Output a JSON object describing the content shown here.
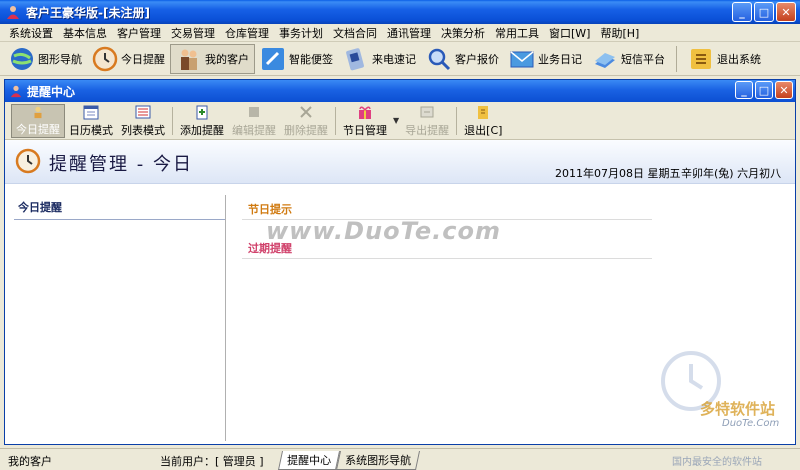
{
  "window": {
    "title": "客户王豪华版-[未注册]"
  },
  "menu": [
    "系统设置",
    "基本信息",
    "客户管理",
    "交易管理",
    "仓库管理",
    "事务计划",
    "文档合同",
    "通讯管理",
    "决策分析",
    "常用工具",
    "窗口[W]",
    "帮助[H]"
  ],
  "main_toolbar": [
    {
      "label": "图形导航",
      "icon": "globe-icon",
      "color": "#2a6ac8"
    },
    {
      "label": "今日提醒",
      "icon": "clock-icon",
      "color": "#d87a20"
    },
    {
      "label": "我的客户",
      "icon": "people-icon",
      "color": "#8a5a2a"
    },
    {
      "label": "智能便签",
      "icon": "note-icon",
      "color": "#2a7ad8"
    },
    {
      "label": "来电速记",
      "icon": "phone-icon",
      "color": "#4a6ab8"
    },
    {
      "label": "客户报价",
      "icon": "search-person-icon",
      "color": "#2a5ab8"
    },
    {
      "label": "业务日记",
      "icon": "envelope-icon",
      "color": "#3a8ad0"
    },
    {
      "label": "短信平台",
      "icon": "book-icon",
      "color": "#2a6ac8"
    },
    {
      "label": "退出系统",
      "icon": "exit-icon",
      "color": "#e8a820"
    }
  ],
  "inner_window": {
    "title": "提醒中心"
  },
  "sub_toolbar": {
    "today": "今日提醒",
    "calendar": "日历模式",
    "list": "列表模式",
    "add": "添加提醒",
    "edit": "编辑提醒",
    "delete": "删除提醒",
    "holiday": "节日管理",
    "export": "导出提醒",
    "exit": "退出[C]"
  },
  "header": {
    "title": "提醒管理 - 今日",
    "date": "2011年07月08日  星期五",
    "lunar": "辛卯年(兔) 六月初八"
  },
  "left_panel": {
    "title": "今日提醒"
  },
  "right_panel": {
    "holiday": "节日提示",
    "overdue": "过期提醒"
  },
  "watermarks": {
    "center": "www.DuoTe.com",
    "brand": "多特软件站",
    "site": "DuoTe.Com",
    "bottom": "国内最安全的软件站"
  },
  "status": {
    "left": "我的客户",
    "user": "当前用户：[ 管理员 ]",
    "tabs": [
      "提醒中心",
      "系统图形导航"
    ]
  }
}
